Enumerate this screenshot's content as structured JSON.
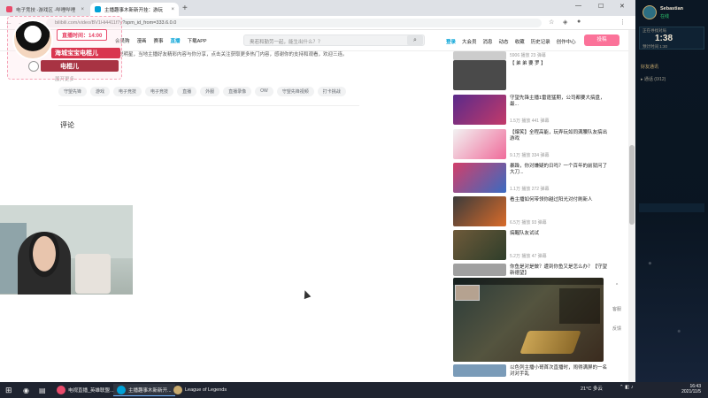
{
  "browser": {
    "tabs": [
      {
        "label": "电子竞技 -游戏区 -哔哩哔哩",
        "fav_color": "#e94b6b"
      },
      {
        "label": "主播趣事木新新开挂：游玩",
        "fav_color": "#00a1d6"
      }
    ],
    "url": "bilibili.com/video/BV1Hi4411f7y?spm_id_from=333.6.0.0"
  },
  "site_header": {
    "nav": [
      "会员购",
      "漫画",
      "赛事",
      "直播",
      "下载APP"
    ],
    "nav_highlight": "直播",
    "search_placeholder": "奥若和勤劳一起，能生出什么？？",
    "right_links": [
      "登录",
      "大会员",
      "消息",
      "动态",
      "收藏",
      "历史记录",
      "创作中心"
    ],
    "upload": "投稿"
  },
  "video": {
    "description": "这个视频精彩片段，电竞解说明星，当地主播好友精彩内容与你分享，点击关注获取更多热门内容，感谢你的支持和观看，欢迎三连。",
    "more_link": "展开更多",
    "tags": [
      "守望先锋",
      "游戏",
      "电子竞技",
      "电子竞技",
      "直播",
      "外服",
      "直播录像",
      "OW",
      "守望先锋视频",
      "打卡挑战"
    ],
    "comments_title": "评论"
  },
  "overlay": {
    "timer_label": "直播时间：14:00",
    "name1": "海城宝宝电棍儿",
    "name2": "电棍儿"
  },
  "recommendations": [
    {
      "title": "",
      "meta": "5906 播放  23 弹幕",
      "color": "#ccc"
    },
    {
      "title": "【 弟 弟 要 罗 】",
      "meta": "",
      "color": "#4a4a4a"
    },
    {
      "title": "守望先锋主播1雷霆猛期，公司都要大搞盘，最...",
      "meta": "1.5万 播放  441 弹幕",
      "color": "#5a2a8a"
    },
    {
      "title": "【爆笑】全程高能，玩弄玩如同满腰队友搞出游戏",
      "meta": "9.1万 播放  334 弹幕",
      "color": "#f2f2f2"
    },
    {
      "title": "暴躁，你对嫌疑的日吗？一个百年的前就问了大刀...",
      "meta": "1.1万 播放  272 弹幕",
      "color": "#d23f6a"
    },
    {
      "title": "看主播如何带领你越过阳光对付刷新人",
      "meta": "6.5万 播放  93 弹幕",
      "color": "#3b3b3b"
    },
    {
      "title": "搞醒队友试试",
      "meta": "5.2万 播放  47 弹幕",
      "color": "#6e5a3a"
    },
    {
      "title": "你鱼是对是做？遭到你鱼又是怎么办？【守望新德望】",
      "meta": "",
      "color": "#a0a0a0"
    },
    {
      "title": "以色列主播小哥首次直播时，闹得满屏的一名对对手乱",
      "meta": "",
      "color": "#7a9bb8"
    }
  ],
  "side_float": {
    "top_label": "^",
    "chat": "客服",
    "feedback": "反馈"
  },
  "game_panel": {
    "player_name": "Sebastian",
    "player_status": "在线",
    "queue_label": "正在寻找对局",
    "timer": "1:38",
    "timer_sub": "预计时间 1:30",
    "section_friends": "好友通讯",
    "row_group": "▸ 通话 (0/12)"
  },
  "taskbar": {
    "apps": [
      {
        "label": "电视直播_英雄联盟...",
        "color": "#e94b6b",
        "active": false
      },
      {
        "label": "主播趣事木新新开...",
        "color": "#00a1d6",
        "active": true
      },
      {
        "label": "League of Legends",
        "color": "#c8aa6e",
        "active": false
      }
    ],
    "weather": "21°C 多云",
    "time": "16:43",
    "date": "2021/11/5"
  }
}
